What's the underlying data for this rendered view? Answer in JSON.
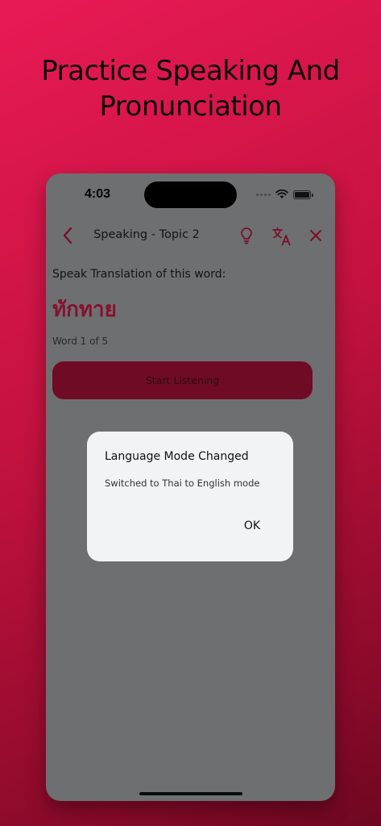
{
  "headline": {
    "line1": "Practice Speaking And",
    "line2": "Pronunciation"
  },
  "status_bar": {
    "time": "4:03",
    "icons": [
      "signal-dots-icon",
      "wifi-icon",
      "battery-icon"
    ]
  },
  "nav": {
    "title": "Speaking - Topic 2",
    "icons": [
      "back-chevron-icon",
      "lightbulb-icon",
      "translate-icon",
      "close-icon"
    ]
  },
  "content": {
    "prompt": "Speak Translation of this word:",
    "word": "ทักทาย",
    "counter": "Word 1 of 5",
    "listen_button": "Start Listening"
  },
  "dialog": {
    "title": "Language Mode Changed",
    "message": "Switched to Thai to English mode",
    "ok_label": "OK"
  },
  "colors": {
    "background_top": "#e81a55",
    "background_bottom": "#6e0721",
    "accent": "#86112f",
    "overlay": "#6e6f70",
    "dialog_bg": "#f2f3f5"
  }
}
